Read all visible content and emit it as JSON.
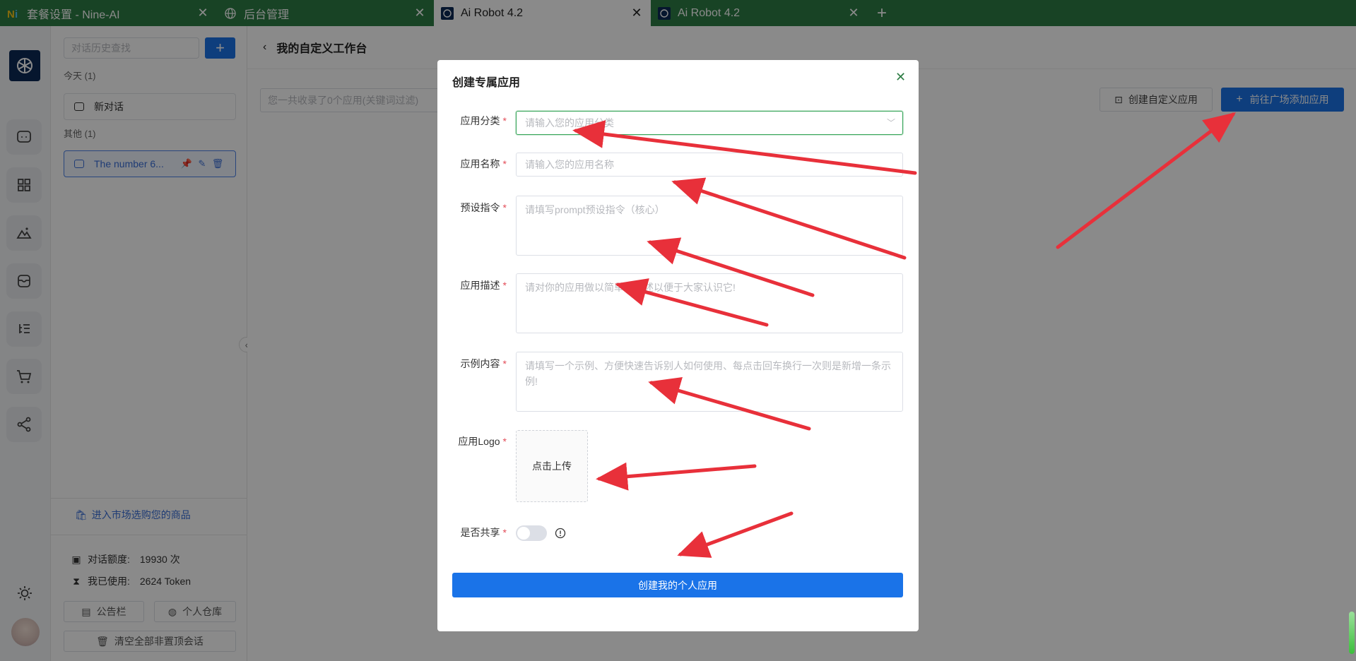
{
  "browser": {
    "tabs": [
      {
        "title": "套餐设置 - Nine-AI",
        "active": false,
        "favicon": "nine-ai-logo"
      },
      {
        "title": "后台管理",
        "active": false,
        "favicon": "globe-icon"
      },
      {
        "title": "Ai Robot 4.2",
        "active": true,
        "favicon": "robot-logo"
      },
      {
        "title": "Ai Robot 4.2",
        "active": false,
        "favicon": "robot-logo"
      }
    ],
    "new_tab": "+",
    "close_glyph": "✕",
    "accent": "#2e7d45"
  },
  "sidebar": {
    "search_placeholder": "对话历史查找",
    "add_label": "+",
    "today_label": "今天 (1)",
    "other_label": "其他 (1)",
    "today_item": "新对话",
    "other_item": "The number 6...",
    "market_link": "进入市场选购您的商品",
    "quota_label": "对话额度:",
    "quota_value": "19930 次",
    "used_label": "我已使用:",
    "used_value": "2624 Token",
    "notice_btn": "公告栏",
    "warehouse_btn": "个人仓库",
    "clear_btn": "清空全部非置顶会话"
  },
  "main": {
    "back": "‹",
    "title": "我的自定义工作台",
    "filter_placeholder": "您一共收录了0个应用(关键词过滤)",
    "custom_btn": "创建自定义应用",
    "market_btn": "前往广场添加应用"
  },
  "modal": {
    "title": "创建专属应用",
    "close": "✕",
    "required_mark": "*",
    "fields": {
      "category": {
        "label": "应用分类",
        "placeholder": "请输入您的应用分类"
      },
      "name": {
        "label": "应用名称",
        "placeholder": "请输入您的应用名称"
      },
      "prompt": {
        "label": "预设指令",
        "placeholder": "请填写prompt预设指令（核心）"
      },
      "desc": {
        "label": "应用描述",
        "placeholder": "请对你的应用做以简单的描述以便于大家认识它!"
      },
      "example": {
        "label": "示例内容",
        "placeholder": "请填写一个示例、方便快速告诉别人如何使用、每点击回车换行一次则是新增一条示例!"
      },
      "logo": {
        "label": "应用Logo",
        "upload": "点击上传"
      },
      "share": {
        "label": "是否共享",
        "value": false
      }
    },
    "submit": "创建我的个人应用"
  },
  "colors": {
    "primary": "#1a73e8",
    "required": "#e34d59",
    "annotation": "#e8303a",
    "focus": "#37a559"
  }
}
